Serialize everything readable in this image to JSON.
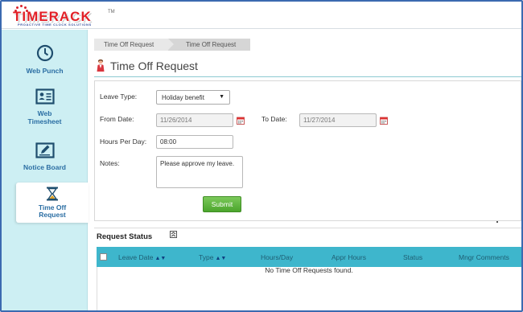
{
  "app": {
    "logo_text": "TIMERACK",
    "logo_tagline": "PROACTIVE TIME CLOCK SOLUTIONS",
    "logo_tm": "TM",
    "accent_color": "#3eb6cc",
    "brand_color": "#e21f26"
  },
  "sidebar": {
    "items": [
      {
        "label": "Web Punch",
        "icon": "clock-icon",
        "active": false
      },
      {
        "label": "Web Timesheet",
        "icon": "id-card-icon",
        "active": false
      },
      {
        "label": "Notice Board",
        "icon": "notice-edit-icon",
        "active": false
      },
      {
        "label": "Time Off Request",
        "icon": "hourglass-icon",
        "active": true
      }
    ]
  },
  "breadcrumb": [
    "Time Off Request",
    "Time Off Request"
  ],
  "page_title": "Time Off Request",
  "form": {
    "leave_type_label": "Leave Type:",
    "leave_type_value": "Holiday benefit",
    "from_date_label": "From Date:",
    "from_date_value": "11/26/2014",
    "to_date_label": "To Date:",
    "to_date_value": "11/27/2014",
    "hours_label": "Hours Per Day:",
    "hours_value": "08:00",
    "notes_label": "Notes:",
    "notes_value": "Please approve my leave.",
    "submit_label": "Submit"
  },
  "request_status": {
    "title": "Request Status",
    "columns": [
      "Leave Date",
      "Type",
      "Hours/Day",
      "Appr Hours",
      "Status",
      "Mngr Comments"
    ],
    "empty_message": "No Time Off Requests found."
  }
}
